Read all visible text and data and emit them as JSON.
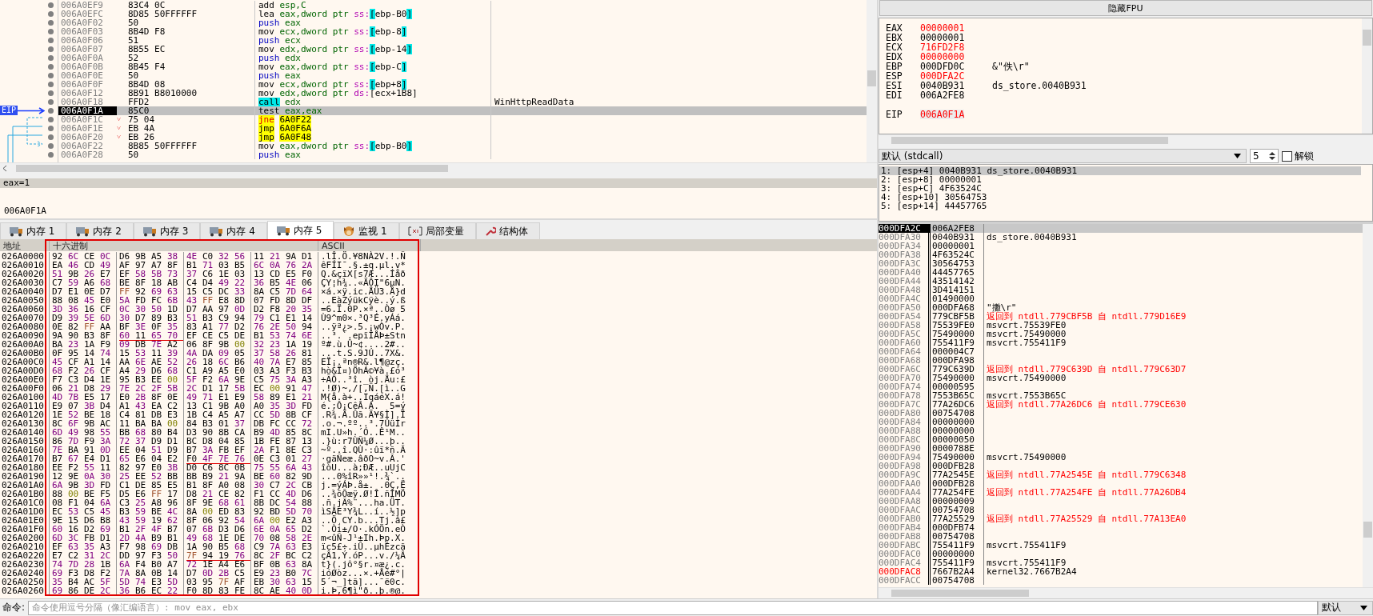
{
  "disassembly": {
    "eip_label": "EIP",
    "rows": [
      {
        "address": "006A0EF9",
        "bytes": "83C4 0C",
        "mnemonic": "add",
        "kind": "plain",
        "operand": "esp,C",
        "selected": false
      },
      {
        "address": "006A0EFC",
        "bytes": "8D85 50FFFFFF",
        "mnemonic": "lea",
        "kind": "plain",
        "operand": "eax,dword ptr ",
        "segment": "ss:",
        "memory": "[ebp-B0]",
        "highlight": true,
        "selected": false
      },
      {
        "address": "006A0F02",
        "bytes": "50",
        "mnemonic": "push",
        "kind": "push",
        "operand": "eax",
        "selected": false
      },
      {
        "address": "006A0F03",
        "bytes": "8B4D F8",
        "mnemonic": "mov",
        "kind": "plain",
        "operand": "ecx,dword ptr ",
        "segment": "ss:",
        "memory": "[ebp-8]",
        "highlight": true,
        "selected": false
      },
      {
        "address": "006A0F06",
        "bytes": "51",
        "mnemonic": "push",
        "kind": "push",
        "operand": "ecx",
        "selected": false
      },
      {
        "address": "006A0F07",
        "bytes": "8B55 EC",
        "mnemonic": "mov",
        "kind": "plain",
        "operand": "edx,dword ptr ",
        "segment": "ss:",
        "memory": "[ebp-14]",
        "highlight": true,
        "selected": false
      },
      {
        "address": "006A0F0A",
        "bytes": "52",
        "mnemonic": "push",
        "kind": "push",
        "operand": "edx",
        "selected": false
      },
      {
        "address": "006A0F0B",
        "bytes": "8B45 F4",
        "mnemonic": "mov",
        "kind": "plain",
        "operand": "eax,dword ptr ",
        "segment": "ss:",
        "memory": "[ebp-C]",
        "highlight": true,
        "selected": false
      },
      {
        "address": "006A0F0E",
        "bytes": "50",
        "mnemonic": "push",
        "kind": "push",
        "operand": "eax",
        "selected": false
      },
      {
        "address": "006A0F0F",
        "bytes": "8B4D 08",
        "mnemonic": "mov",
        "kind": "plain",
        "operand": "ecx,dword ptr ",
        "segment": "ss:",
        "memory": "[ebp+8]",
        "highlight": true,
        "selected": false
      },
      {
        "address": "006A0F12",
        "bytes": "8B91 B8010000",
        "mnemonic": "mov",
        "kind": "plain",
        "operand": "edx,dword ptr ",
        "segment": "ds:",
        "memory": "[ecx+1B8]",
        "highlight": false,
        "selected": false
      },
      {
        "address": "006A0F18",
        "bytes": "FFD2",
        "mnemonic": "call",
        "kind": "call",
        "operand": "edx",
        "comment": "WinHttpReadData",
        "selected": false
      },
      {
        "address": "006A0F1A",
        "bytes": "85C0",
        "mnemonic": "test",
        "kind": "plain",
        "operand": "eax,eax",
        "selected": true
      },
      {
        "address": "006A0F1C",
        "branch": "˅",
        "bytes": "75 04",
        "mnemonic": "jne",
        "kind": "jcc",
        "target": "6A0F22",
        "selected": false
      },
      {
        "address": "006A0F1E",
        "branch": "˅",
        "bytes": "EB 4A",
        "mnemonic": "jmp",
        "kind": "jmp",
        "target": "6A0F6A",
        "selected": false
      },
      {
        "address": "006A0F20",
        "branch": "˅",
        "bytes": "EB 26",
        "mnemonic": "jmp",
        "kind": "jmp",
        "target": "6A0F48",
        "selected": false
      },
      {
        "address": "006A0F22",
        "bytes": "8B85 50FFFFFF",
        "mnemonic": "mov",
        "kind": "plain",
        "operand": "eax,dword ptr ",
        "segment": "ss:",
        "memory": "[ebp-B0]",
        "highlight": true,
        "selected": false
      },
      {
        "address": "006A0F28",
        "bytes": "50",
        "mnemonic": "push",
        "kind": "push",
        "operand": "eax",
        "selected": false
      }
    ]
  },
  "info": {
    "header": "eax=1",
    "address": "006A0F1A"
  },
  "fpu_button": "隐藏FPU",
  "registers": [
    {
      "name": "EAX",
      "value": "00000001",
      "changed": true
    },
    {
      "name": "EBX",
      "value": "00000001",
      "changed": false
    },
    {
      "name": "ECX",
      "value": "716FD2F8",
      "changed": true
    },
    {
      "name": "EDX",
      "value": "00000000",
      "changed": true
    },
    {
      "name": "EBP",
      "value": "000DFD0C",
      "comment": "&\"佚\\r\"",
      "changed": false
    },
    {
      "name": "ESP",
      "value": "000DFA2C",
      "changed": true
    },
    {
      "name": "ESI",
      "value": "0040B931",
      "comment": "ds_store.0040B931",
      "changed": false
    },
    {
      "name": "EDI",
      "value": "006A2FE8",
      "changed": false
    }
  ],
  "eip": {
    "name": "EIP",
    "value": "006A0F1A",
    "changed": true
  },
  "call_convention": {
    "value": "默认 (stdcall)",
    "count": "5",
    "unlock_label": "解锁",
    "unlock_checked": false
  },
  "arguments": [
    {
      "text": "1: [esp+4] 0040B931 ds_store.0040B931",
      "selected": true
    },
    {
      "text": "2: [esp+8] 00000001",
      "selected": false
    },
    {
      "text": "3: [esp+C] 4F63524C",
      "selected": false
    },
    {
      "text": "4: [esp+10] 30564753",
      "selected": false
    },
    {
      "text": "5: [esp+14] 44457765",
      "selected": false
    }
  ],
  "tabs": [
    {
      "label": "内存 1",
      "kind": "memory",
      "selected": false
    },
    {
      "label": "内存 2",
      "kind": "memory",
      "selected": false
    },
    {
      "label": "内存 3",
      "kind": "memory",
      "selected": false
    },
    {
      "label": "内存 4",
      "kind": "memory",
      "selected": false
    },
    {
      "label": "内存 5",
      "kind": "memory",
      "selected": true
    },
    {
      "label": "监视 1",
      "kind": "watch",
      "selected": false
    },
    {
      "label": "局部变量",
      "kind": "locals",
      "selected": false
    },
    {
      "label": "结构体",
      "kind": "struct",
      "selected": false
    }
  ],
  "dump": {
    "columns": [
      "地址",
      "十六进制",
      "ASCII"
    ],
    "rows": [
      {
        "address": "026A0000",
        "hex": "92 6C CE 0C D6 9B A5 38 4E C0 32 56 11 21 9A D1",
        "ascii": ".lÎ.Ö.¥8NÀ2V.!.Ñ"
      },
      {
        "address": "026A0010",
        "hex": "EA 46 CD 49 AF 97 A7 8F B1 71 03 B5 6C 0A 76 2A",
        "ascii": "êFÍI¯.§.±q.µl.v*"
      },
      {
        "address": "026A0020",
        "hex": "51 9B 26 E7 EF 58 5B 73 37 C6 1E 03 13 CD E5 F0",
        "ascii": "Q.&çïX[s7Æ...Íåð"
      },
      {
        "address": "026A0030",
        "hex": "C7 59 A6 68 BE 8F 18 AB C4 D4 49 22 36 B5 4E 06",
        "ascii": "ÇY¦h¾..«ÄÔI\"6µN."
      },
      {
        "address": "026A0040",
        "hex": "D7 E1 0E D7 FF 92 69 63 15 C5 DC 33 8A C5 7D 64",
        "ascii": "×á.×ÿ.ic.ÅÜ3.Å}d"
      },
      {
        "address": "026A0050",
        "hex": "88 08 45 E0 5A FD FC 6B 43 FF E8 8D 07 FD 8D DF",
        "ascii": "..EàZýükCÿè..ý.ß"
      },
      {
        "address": "026A0060",
        "hex": "3D 36 16 CF 0C 30 50 1D D7 AA 97 0D D2 F8 20 35",
        "ascii": "=6.Ï.0P.×ª..Òø 5"
      },
      {
        "address": "026A0070",
        "hex": "D9 39 5E 6D 30 D7 89 B3 51 B3 C9 94 79 C1 E1 14",
        "ascii": "Ù9^m0×.³Q³É.yÁá."
      },
      {
        "address": "026A0080",
        "hex": "0E 82 FF AA BF 3E 0F 35 83 A1 77 D2 76 2E 50 94",
        "ascii": "..ÿª¿>.5.¡wÒv.P."
      },
      {
        "address": "026A0090",
        "hex": "9A 90 B3 8F 60 11 65 70 EF CE C5 DE B1 53 74 6E",
        "ascii": "..³.`.epïÎÅÞ±Stn",
        "underlined": [
          false,
          true,
          false,
          false
        ]
      },
      {
        "address": "026A00A0",
        "hex": "BA 23 1A F9 09 DB 7E A2 06 8F 9B 00 32 23 1A 19",
        "ascii": "º#.ù.Û~¢....2#.."
      },
      {
        "address": "026A00B0",
        "hex": "0F 95 14 74 15 53 11 39 4A DA 09 05 37 58 26 81",
        "ascii": "...t.S.9JÚ..7X&."
      },
      {
        "address": "026A00C0",
        "hex": "45 CF A1 14 AA 6E AE 52 26 18 6C B6 40 7A E7 85",
        "ascii": "EÏ¡.ªn®R&.l¶@zç."
      },
      {
        "address": "026A00D0",
        "hex": "68 F2 26 CF A4 29 D6 68 C1 A9 A5 E0 03 A3 F3 B3",
        "ascii": "hò&Ï¤)ÖhÁ©¥à.£ó³"
      },
      {
        "address": "026A00E0",
        "hex": "F7 C3 D4 1E 95 B3 EE 00 5F F2 6A 9E C5 75 3A A3",
        "ascii": "÷ÃÔ..³î._òj.Åu:£"
      },
      {
        "address": "026A00F0",
        "hex": "06 21 D8 29 7E 2C 2F 5B 2C D1 17 5B EC 00 91 47",
        "ascii": ".!Ø)~,/[,Ñ.[ì..G"
      },
      {
        "address": "026A0100",
        "hex": "4D 7B E5 17 E0 2B 8F 0E 49 71 E1 E9 58 89 E1 21",
        "ascii": "M{å.à+..IqáéX.á!"
      },
      {
        "address": "026A0110",
        "hex": "E9 07 3B D4 A1 43 EA C2 13 C1 9B A0 A0 35 3D FD",
        "ascii": "é.;Ô¡CêÂ.Á.  5=ý"
      },
      {
        "address": "026A0120",
        "hex": "1E 52 BE 18 C4 81 DB E3 1B C4 A5 A7 CC 5D 8B CF",
        "ascii": ".R¾.Ä.Ûã.Ä¥§Ì].Ï"
      },
      {
        "address": "026A0130",
        "hex": "8C 6F 9B AC 11 BA BA 00 84 B3 01 37 DB FC CC 72",
        "ascii": ".o.¬.ºº..³.7ÛüÌr"
      },
      {
        "address": "026A0140",
        "hex": "6D 49 98 55 BB 68 80 B4 D3 90 8B CA B9 4D 85 8C",
        "ascii": "mI.U»h.´Ó..Ê¹M.."
      },
      {
        "address": "026A0150",
        "hex": "86 7D F9 3A 72 37 D9 D1 BC D8 04 85 1B FE 87 13",
        "ascii": ".}ù:r7ÙÑ¼Ø...þ.."
      },
      {
        "address": "026A0160",
        "hex": "7E BA 91 0D EE 04 51 D9 B7 3A FB EF 2A F1 8E C3",
        "ascii": "~º..î.QÙ·:ûï*ñ.Ã"
      },
      {
        "address": "026A0170",
        "hex": "B7 67 E4 D1 65 E6 04 E2 F0 4F 7E 76 0E C3 01 27",
        "ascii": "·gäÑeæ.âðO~v.Ã.'",
        "underlined": [
          false,
          false,
          true,
          false
        ]
      },
      {
        "address": "026A0180",
        "hex": "EE F2 55 11 82 97 E0 3B D0 C6 8C 0B 75 55 6A 43",
        "ascii": "îòU...à;ÐÆ..uUjC"
      },
      {
        "address": "026A0190",
        "hex": "12 9E 0A 30 25 EE 52 BB BB B9 21 9A BE 60 82 9D",
        "ascii": "...0%îR»»¹!.¾`.."
      },
      {
        "address": "026A01A0",
        "hex": "6A 9B 3D FD C1 DE 85 E5 B1 8F A0 08 30 C7 2C CB",
        "ascii": "j.=ýÁÞ.å±. .0Ç,Ë"
      },
      {
        "address": "026A01B0",
        "hex": "88 00 BE F5 D5 E6 FF 17 D8 21 CE 82 F1 CC 4D D6",
        "ascii": "..¾õÕæÿ.Ø!Î.ñÌMÖ"
      },
      {
        "address": "026A01C0",
        "hex": "08 F1 04 6A C3 25 A8 96 8F 9E 68 61 8B DC 54 88",
        "ascii": ".ñ.jÃ%¨...ha.ÜT."
      },
      {
        "address": "026A01D0",
        "hex": "EC 53 C5 45 B3 59 BE 4C 8A 00 ED 83 92 BD 5D 70",
        "ascii": "ìSÅE³Y¾L..í..½]p"
      },
      {
        "address": "026A01E0",
        "hex": "9E 15 D6 B8 43 59 19 62 8F 06 92 54 6A 00 E2 A3",
        "ascii": "..Ö¸CY.b...Tj.â£"
      },
      {
        "address": "026A01F0",
        "hex": "60 16 D2 69 B1 2F 4F B7 07 6B D3 D6 6E 0A 65 D2",
        "ascii": "`.Òi±/O·.kÓÖn.eÒ"
      },
      {
        "address": "026A0200",
        "hex": "6D 3C FB D1 2D 4A B9 B1 49 68 1E DE 70 08 58 2E",
        "ascii": "m<ûÑ-J¹±Ih.Þp.X."
      },
      {
        "address": "026A0210",
        "hex": "EF 63 35 A3 F7 98 69 DB 1A 90 B5 68 C9 7A 63 E3",
        "ascii": "ïc5£÷.iÛ..µhÉzcã"
      },
      {
        "address": "026A0220",
        "hex": "E7 C2 31 2C DD 97 F3 50 7F 94 19 76 8C 2F BC C2",
        "ascii": "çÂ1,Ý.óP...v./¼Â",
        "underlined": [
          false,
          false,
          true,
          false
        ]
      },
      {
        "address": "026A0230",
        "hex": "74 7D 28 1B 6A F4 B0 A7 72 1E A4 E6 BF 0B 63 8A",
        "ascii": "t}(.jô°§r.¤æ¿.c."
      },
      {
        "address": "026A0240",
        "hex": "69 F3 D8 F2 7A 8A 0B 14 D7 0D 2B C5 E9 23 B0 7C",
        "ascii": "ióØòz...×.+Åé#°|"
      },
      {
        "address": "026A0250",
        "hex": "35 B4 AC 5F 5D 74 E3 5D 03 95 7F AF EB 30 63 15",
        "ascii": "5´¬_]tã]...¯ë0c."
      },
      {
        "address": "026A0260",
        "hex": "69 86 DE 2C 36 B6 EC 22 F0 8D 83 FE 8C AE 40 0D",
        "ascii": "i.Þ,6¶ì\"ð..þ.®@."
      }
    ]
  },
  "stack": [
    {
      "address": "000DFA2C",
      "value": "006A2FE8",
      "selected": true,
      "address_red": false
    },
    {
      "address": "000DFA30",
      "value": "0040B931",
      "comment": "ds_store.0040B931",
      "kind": "plain",
      "selected": false,
      "address_red": false
    },
    {
      "address": "000DFA34",
      "value": "00000001",
      "selected": false,
      "address_red": false
    },
    {
      "address": "000DFA38",
      "value": "4F63524C",
      "selected": false,
      "address_red": false
    },
    {
      "address": "000DFA3C",
      "value": "30564753",
      "selected": false,
      "address_red": false
    },
    {
      "address": "000DFA40",
      "value": "44457765",
      "selected": false,
      "address_red": false
    },
    {
      "address": "000DFA44",
      "value": "43514142",
      "selected": false,
      "address_red": false
    },
    {
      "address": "000DFA48",
      "value": "3D414151",
      "selected": false,
      "address_red": false
    },
    {
      "address": "000DFA4C",
      "value": "01490000",
      "selected": false,
      "address_red": false
    },
    {
      "address": "000DFA50",
      "value": "000DFA68",
      "comment": "\"擻\\r\"",
      "kind": "plain",
      "selected": false,
      "address_red": false
    },
    {
      "address": "000DFA54",
      "value": "779CBF5B",
      "comment": "返回到 ntdll.779CBF5B 自 ntdll.779D16E9",
      "kind": "return",
      "selected": false,
      "address_red": false
    },
    {
      "address": "000DFA58",
      "value": "75539FE0",
      "comment": "msvcrt.75539FE0",
      "kind": "plain",
      "selected": false,
      "address_red": false
    },
    {
      "address": "000DFA5C",
      "value": "75490000",
      "comment": "msvcrt.75490000",
      "kind": "plain",
      "selected": false,
      "address_red": false
    },
    {
      "address": "000DFA60",
      "value": "755411F9",
      "comment": "msvcrt.755411F9",
      "kind": "plain",
      "selected": false,
      "address_red": false
    },
    {
      "address": "000DFA64",
      "value": "000004C7",
      "selected": false,
      "address_red": false
    },
    {
      "address": "000DFA68",
      "value": "000DFA98",
      "selected": false,
      "address_red": false
    },
    {
      "address": "000DFA6C",
      "value": "779C639D",
      "comment": "返回到 ntdll.779C639D 自 ntdll.779C63D7",
      "kind": "return",
      "selected": false,
      "address_red": false
    },
    {
      "address": "000DFA70",
      "value": "75490000",
      "comment": "msvcrt.75490000",
      "kind": "plain",
      "selected": false,
      "address_red": false
    },
    {
      "address": "000DFA74",
      "value": "00000595",
      "selected": false,
      "address_red": false
    },
    {
      "address": "000DFA78",
      "value": "7553B65C",
      "comment": "msvcrt.7553B65C",
      "kind": "plain",
      "selected": false,
      "address_red": false
    },
    {
      "address": "000DFA7C",
      "value": "77A26DC6",
      "comment": "返回到 ntdll.77A26DC6 自 ntdll.779CE630",
      "kind": "return",
      "selected": false,
      "address_red": false
    },
    {
      "address": "000DFA80",
      "value": "00754708",
      "selected": false,
      "address_red": false
    },
    {
      "address": "000DFA84",
      "value": "00000000",
      "selected": false,
      "address_red": false
    },
    {
      "address": "000DFA88",
      "value": "00000000",
      "selected": false,
      "address_red": false
    },
    {
      "address": "000DFA8C",
      "value": "00000050",
      "selected": false,
      "address_red": false
    },
    {
      "address": "000DFA90",
      "value": "0000788E",
      "selected": false,
      "address_red": false
    },
    {
      "address": "000DFA94",
      "value": "75490000",
      "comment": "msvcrt.75490000",
      "kind": "plain",
      "selected": false,
      "address_red": false
    },
    {
      "address": "000DFA98",
      "value": "000DFB28",
      "selected": false,
      "address_red": false
    },
    {
      "address": "000DFA9C",
      "value": "77A2545E",
      "comment": "返回到 ntdll.77A2545E 自 ntdll.779C6348",
      "kind": "return",
      "selected": false,
      "address_red": false
    },
    {
      "address": "000DFAA0",
      "value": "000DFB28",
      "selected": false,
      "address_red": false
    },
    {
      "address": "000DFAA4",
      "value": "77A254FE",
      "comment": "返回到 ntdll.77A254FE 自 ntdll.77A26DB4",
      "kind": "return",
      "selected": false,
      "address_red": false
    },
    {
      "address": "000DFAA8",
      "value": "00000009",
      "selected": false,
      "address_red": false
    },
    {
      "address": "000DFAAC",
      "value": "00754708",
      "selected": false,
      "address_red": false
    },
    {
      "address": "000DFAB0",
      "value": "77A25529",
      "comment": "返回到 ntdll.77A25529 自 ntdll.77A13EA0",
      "kind": "return",
      "selected": false,
      "address_red": false
    },
    {
      "address": "000DFAB4",
      "value": "000DFB74",
      "selected": false,
      "address_red": false
    },
    {
      "address": "000DFAB8",
      "value": "00754708",
      "selected": false,
      "address_red": false
    },
    {
      "address": "000DFABC",
      "value": "755411F9",
      "comment": "msvcrt.755411F9",
      "kind": "plain",
      "selected": false,
      "address_red": false
    },
    {
      "address": "000DFAC0",
      "value": "00000000",
      "selected": false,
      "address_red": false
    },
    {
      "address": "000DFAC4",
      "value": "755411F9",
      "comment": "msvcrt.755411F9",
      "kind": "plain",
      "selected": false,
      "address_red": false
    },
    {
      "address": "000DFAC8",
      "value": "7667B2A4",
      "comment": "kernel32.7667B2A4",
      "kind": "plain",
      "selected": false,
      "address_red": true
    },
    {
      "address": "000DFACC",
      "value": "00754708",
      "selected": false,
      "address_red": false
    }
  ],
  "command": {
    "label": "命令:",
    "placeholder": "命令使用逗号分隔（像汇编语言）: mov eax, ebx",
    "mode": "默认"
  }
}
